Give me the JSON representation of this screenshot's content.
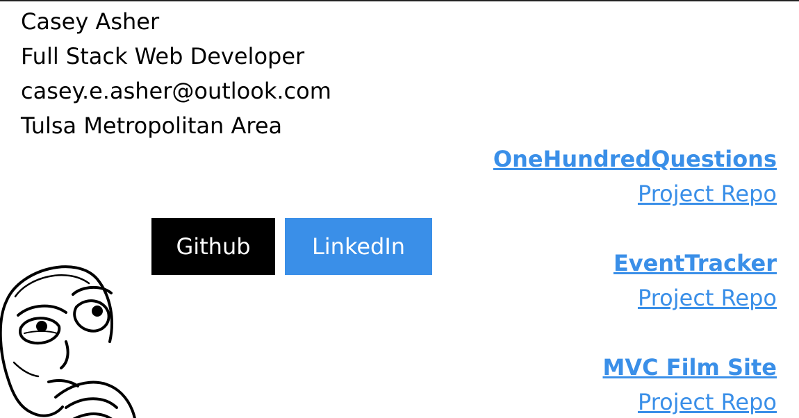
{
  "profile": {
    "name": "Casey Asher",
    "title": "Full Stack Web Developer",
    "email": "casey.e.asher@outlook.com",
    "location": "Tulsa Metropolitan Area"
  },
  "buttons": {
    "github": "Github",
    "linkedin": "LinkedIn"
  },
  "projects": [
    {
      "title": "OneHundredQuestions",
      "repo_label": "Project Repo"
    },
    {
      "title": "EventTracker",
      "repo_label": "Project Repo"
    },
    {
      "title": "MVC Film Site",
      "repo_label": "Project Repo"
    }
  ],
  "colors": {
    "accent": "#3a8fe8",
    "github_bg": "#000000",
    "text": "#000000"
  },
  "image": {
    "icon": "thinking-face-icon"
  }
}
